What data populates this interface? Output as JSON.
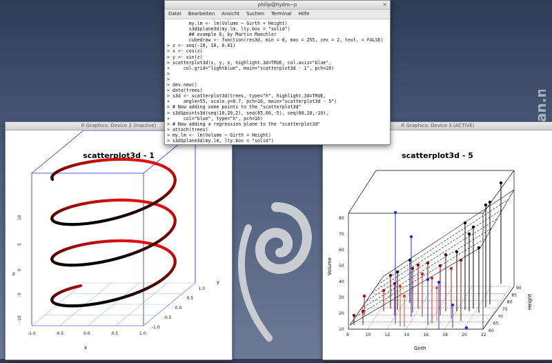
{
  "desktop": {
    "watermark": "screenshots.debian.net"
  },
  "left_window": {
    "title": "R Graphics: Device 2 (inactive)",
    "plot_title": "scatterplot3d - 1",
    "xlabel": "x",
    "ylabel": "y",
    "zlabel": "z",
    "x_ticks": [
      "-1.0",
      "-0.5",
      "0.0",
      "0.5",
      "1.0"
    ],
    "y_ticks": [
      "-1.0",
      "-0.5",
      "0.0",
      "0.5",
      "1.0"
    ],
    "z_ticks": [
      "10",
      "5",
      "0",
      "-5",
      "-10"
    ]
  },
  "right_window": {
    "title": "R Graphics: Device 3 (ACTIVE)",
    "plot_title": "scatterplot3d - 5",
    "xlabel": "Girth",
    "ylabel": "Height",
    "zlabel": "Volume",
    "x_ticks": [
      "8",
      "10",
      "12",
      "14",
      "16",
      "18",
      "20",
      "22"
    ],
    "y_ticks": [
      "60",
      "65",
      "70",
      "75",
      "80",
      "85",
      "90"
    ],
    "z_ticks": [
      "10",
      "20",
      "30",
      "40",
      "50",
      "60",
      "70",
      "80"
    ]
  },
  "terminal": {
    "title": "philip@hydro~p",
    "close": "×",
    "menu": [
      "Datei",
      "Bearbeiten",
      "Ansicht",
      "Suchen",
      "Terminal",
      "Hilfe"
    ],
    "lines": [
      "        my.lm <- lm(Volume ~ Girth + Height)",
      "        s3d$plane3d(my.lm, lty.box = \"solid\")",
      "",
      "        ## example 6; by Martin Maechler",
      "        cubedraw <- function(res3d, min = 0, max = 255, cex = 2, text. = FALSE)",
      "> z <- seq(-10, 10, 0.01)",
      "> x <- cos(z)",
      "> y <- sin(z)",
      "> scatterplot3d(x, y, z, highlight.3d=TRUE, col.axis=\"blue\",",
      "+     col.grid=\"lightblue\", main=\"scatterplot3d - 1\", pch=20)",
      ">",
      ">",
      "> dev.new()",
      "> data(trees)",
      "> s3d <- scatterplot3d(trees, type=\"h\", highlight.3d=TRUE,",
      "+     angle=55, scale.y=0.7, pch=16, main=\"scatterplot3d - 5\")",
      "> # Now adding some points to the \"scatterplot3d\"",
      "> s3d$points3d(seq(10,20,2), seq(85,60,-5), seq(60,10,-10),",
      "+     col=\"blue\", type=\"h\", pch=16)",
      "> # Now adding a regression plane to the \"scatterplot3d\"",
      "> attach(trees)",
      "> my.lm <- lm(Volume ~ Girth + Height)",
      "> s3d$plane3d(my.lm, lty.box = \"solid\")",
      "> "
    ]
  },
  "colors": {
    "axis_blue": "#2222dd",
    "grid_blue": "#9db4e8",
    "helix_dark": "#000000",
    "helix_red": "#e01010",
    "blue_points": "#1a2ee8"
  }
}
